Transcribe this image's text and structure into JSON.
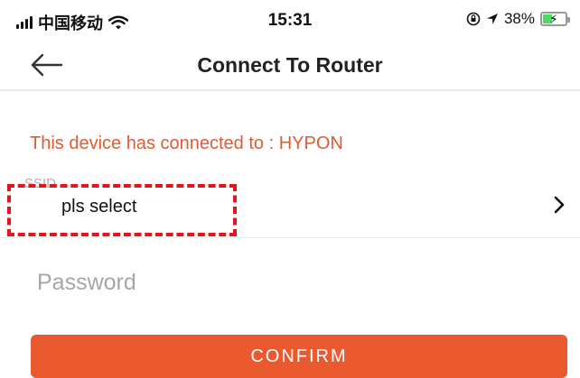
{
  "status_bar": {
    "carrier": "中国移动",
    "time": "15:31",
    "battery": "38%",
    "battery_level": 0.38,
    "icons": [
      "signal-icon",
      "wifi-icon",
      "rotation-lock-icon",
      "location-icon",
      "battery-icon"
    ]
  },
  "header": {
    "title": "Connect To Router",
    "back_icon": "back-arrow-icon"
  },
  "main": {
    "status_message": "This device has connected to : HYPON",
    "ssid_label": "SSID",
    "ssid_value": "pls select",
    "chevron_icon": "chevron-right-icon",
    "password_placeholder": "Password",
    "confirm_label": "CONFIRM"
  },
  "colors": {
    "accent": "#ea5a2e",
    "status_text": "#e05a35",
    "highlight": "#e3141c"
  }
}
